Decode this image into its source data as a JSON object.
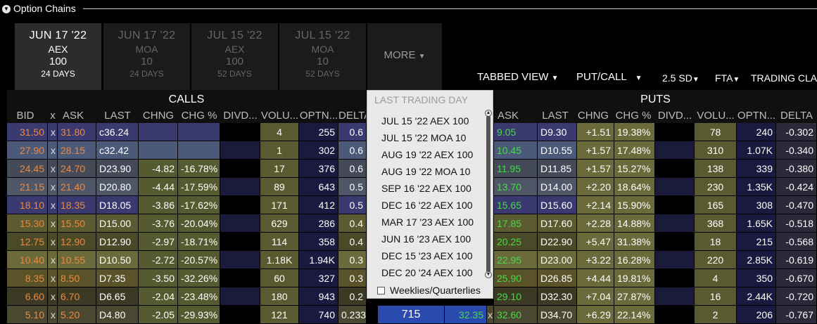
{
  "window": {
    "title": "Option Chains"
  },
  "expiry_tabs": [
    {
      "date": "JUN 17 '22",
      "symbol": "AEX",
      "multiplier": "100",
      "days": "24 DAYS",
      "active": true
    },
    {
      "date": "JUN 17 '22",
      "symbol": "MOA",
      "multiplier": "10",
      "days": "24 DAYS",
      "active": false
    },
    {
      "date": "JUL 15 '22",
      "symbol": "AEX",
      "multiplier": "100",
      "days": "52 DAYS",
      "active": false
    },
    {
      "date": "JUL 15 '22",
      "symbol": "MOA",
      "multiplier": "10",
      "days": "52 DAYS",
      "active": false
    }
  ],
  "more_label": "MORE",
  "controls": {
    "view": "TABBED VIEW",
    "mode": "PUT/CALL",
    "sd": "2.5 SD",
    "fta": "FTA",
    "trading_class": "TRADING CLA"
  },
  "groups": {
    "calls": "CALLS",
    "puts": "PUTS"
  },
  "call_headers": [
    "BID",
    "x",
    "ASK",
    "LAST",
    "CHNG",
    "CHG %",
    "DIVD...",
    "VOLU...",
    "OPTN...",
    "DELTA"
  ],
  "put_headers": [
    "ASK",
    "LAST",
    "CHNG",
    "CHG %",
    "DIVD...",
    "VOLU...",
    "OPTN...",
    "DELTA"
  ],
  "rows": [
    {
      "bid": "31.50",
      "ask": "31.80",
      "last": "c36.24",
      "chng": "",
      "chgpct": "",
      "vol": "4",
      "optn": "255",
      "delta": "0.6",
      "p_bid": "",
      "p_ask": "9.05",
      "p_last": "D9.30",
      "p_chng": "+1.51",
      "p_chgpct": "19.38%",
      "p_vol": "78",
      "p_optn": "240",
      "p_delta": "-0.302"
    },
    {
      "bid": "27.90",
      "ask": "28.15",
      "last": "c32.42",
      "chng": "",
      "chgpct": "",
      "vol": "1",
      "optn": "302",
      "delta": "0.6",
      "p_bid": "",
      "p_ask": "10.45",
      "p_last": "D10.55",
      "p_chng": "+1.57",
      "p_chgpct": "17.48%",
      "p_vol": "310",
      "p_optn": "1.07K",
      "p_delta": "-0.340"
    },
    {
      "bid": "24.45",
      "ask": "24.70",
      "last": "D23.90",
      "chng": "-4.82",
      "chgpct": "-16.78%",
      "vol": "17",
      "optn": "376",
      "delta": "0.6",
      "p_bid": "",
      "p_ask": "11.95",
      "p_last": "D11.85",
      "p_chng": "+1.57",
      "p_chgpct": "15.27%",
      "p_vol": "138",
      "p_optn": "339",
      "p_delta": "-0.380"
    },
    {
      "bid": "21.15",
      "ask": "21.40",
      "last": "D20.80",
      "chng": "-4.44",
      "chgpct": "-17.59%",
      "vol": "89",
      "optn": "643",
      "delta": "0.5",
      "p_bid": "",
      "p_ask": "13.70",
      "p_last": "D14.00",
      "p_chng": "+2.20",
      "p_chgpct": "18.64%",
      "p_vol": "230",
      "p_optn": "1.35K",
      "p_delta": "-0.424"
    },
    {
      "bid": "18.10",
      "ask": "18.35",
      "last": "D18.05",
      "chng": "-3.86",
      "chgpct": "-17.62%",
      "vol": "171",
      "optn": "412",
      "delta": "0.5",
      "p_bid": "",
      "p_ask": "15.65",
      "p_last": "D15.60",
      "p_chng": "+2.14",
      "p_chgpct": "15.90%",
      "p_vol": "165",
      "p_optn": "308",
      "p_delta": "-0.470"
    },
    {
      "bid": "15.30",
      "ask": "15.50",
      "last": "D15.00",
      "chng": "-3.76",
      "chgpct": "-20.04%",
      "vol": "629",
      "optn": "286",
      "delta": "0.4",
      "p_bid": "",
      "p_ask": "17.85",
      "p_last": "D17.60",
      "p_chng": "+2.28",
      "p_chgpct": "14.88%",
      "p_vol": "368",
      "p_optn": "1.65K",
      "p_delta": "-0.518"
    },
    {
      "bid": "12.75",
      "ask": "12.90",
      "last": "D12.90",
      "chng": "-2.97",
      "chgpct": "-18.71%",
      "vol": "114",
      "optn": "358",
      "delta": "0.4",
      "p_bid": "",
      "p_ask": "20.25",
      "p_last": "D22.90",
      "p_chng": "+5.47",
      "p_chgpct": "31.38%",
      "p_vol": "18",
      "p_optn": "215",
      "p_delta": "-0.568"
    },
    {
      "bid": "10.40",
      "ask": "10.55",
      "last": "D10.50",
      "chng": "-2.72",
      "chgpct": "-20.57%",
      "vol": "1.18K",
      "optn": "1.94K",
      "delta": "0.3",
      "p_bid": "",
      "p_ask": "22.95",
      "p_last": "D23.00",
      "p_chng": "+3.22",
      "p_chgpct": "16.28%",
      "p_vol": "220",
      "p_optn": "2.85K",
      "p_delta": "-0.619"
    },
    {
      "bid": "8.35",
      "ask": "8.50",
      "last": "D7.35",
      "chng": "-3.50",
      "chgpct": "-32.26%",
      "vol": "60",
      "optn": "327",
      "delta": "0.3",
      "p_bid": "",
      "p_ask": "25.90",
      "p_last": "D26.85",
      "p_chng": "+4.44",
      "p_chgpct": "19.81%",
      "p_vol": "4",
      "p_optn": "350",
      "p_delta": "-0.670"
    },
    {
      "bid": "6.60",
      "ask": "6.70",
      "last": "D6.65",
      "chng": "-2.04",
      "chgpct": "-23.48%",
      "vol": "180",
      "optn": "943",
      "delta": "0.2",
      "p_bid": "",
      "p_ask": "29.10",
      "p_last": "D32.30",
      "p_chng": "+7.04",
      "p_chgpct": "27.87%",
      "p_vol": "16",
      "p_optn": "2.44K",
      "p_delta": "-0.720"
    },
    {
      "bid": "5.10",
      "ask": "5.20",
      "last": "D4.80",
      "chng": "-2.05",
      "chgpct": "-29.93%",
      "vol": "121",
      "optn": "740",
      "delta": "0.233",
      "strike": "715",
      "p_bid": "32.35",
      "p_ask": "32.60",
      "p_last": "D34.70",
      "p_chng": "+6.29",
      "p_chgpct": "22.14%",
      "p_vol": "2",
      "p_optn": "206",
      "p_delta": "-0.767"
    }
  ],
  "dropdown": {
    "header": "LAST TRADING DAY",
    "items": [
      "JUL 15 '22 AEX 100",
      "JUL 15 '22 MOA 10",
      "AUG 19 '22 AEX 100",
      "AUG 19 '22 MOA 10",
      "SEP 16 '22 AEX 100",
      "DEC 16 '22 AEX 100",
      "MAR 17 '23 AEX 100",
      "JUN 16 '23 AEX 100",
      "DEC 15 '23 AEX 100",
      "DEC 20 '24 AEX 100"
    ],
    "checkbox_label": "Weeklies/Quarterlies"
  }
}
